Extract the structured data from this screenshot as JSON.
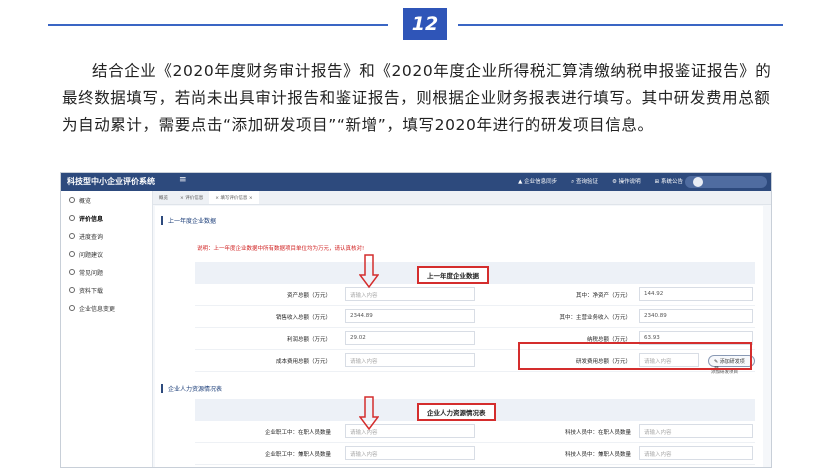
{
  "header": {
    "step_number": "12"
  },
  "intro_text": "结合企业《2020年度财务审计报告》和《2020年度企业所得税汇算清缴纳税申报鉴证报告》的最终数据填写，若尚未出具审计报告和鉴证报告，则根据企业财务报表进行填写。其中研发费用总额为自动累计，需要点击“添加研发项目”“新增”，填写2020年进行的研发项目信息。",
  "app": {
    "title": "科技型中小企业评价系统",
    "menu_icon": "≡",
    "topnav": [
      "▲ 企业信息同步",
      "⌕ 查询验证",
      "⚙ 操作说明",
      "⊞ 系统公告"
    ],
    "sidebar": [
      {
        "label": "概览",
        "active": false
      },
      {
        "label": "评价信息",
        "active": true
      },
      {
        "label": "进度查询",
        "active": false
      },
      {
        "label": "问题建议",
        "active": false
      },
      {
        "label": "常见问题",
        "active": false
      },
      {
        "label": "资料下载",
        "active": false
      },
      {
        "label": "企业信息变更",
        "active": false
      }
    ],
    "tabs": [
      "概览",
      "× 评价信息",
      "× 填写评价信息 ×"
    ],
    "section1_title": "上一年度企业数据",
    "notice": "说明：上一年度企业数据中所有数据项目单位均为万元，请认真核对!",
    "table1_header": "上一年度企业数据",
    "rows1": [
      {
        "l1": "资产总额（万元）",
        "v1": "请输入内容",
        "l2": "其中：净资产（万元）",
        "v2": "144.92"
      },
      {
        "l1": "销售收入总额（万元）",
        "v1": "2344.89",
        "l2": "其中：主营业务收入（万元）",
        "v2": "2340.89"
      },
      {
        "l1": "利润总额（万元）",
        "v1": "29.02",
        "l2": "纳税总额（万元）",
        "v2": "63.93"
      },
      {
        "l1": "成本费用总额（万元）",
        "v1": "请输入内容",
        "l2": "研发费用总额（万元）",
        "v2": "请输入内容"
      }
    ],
    "add_rd_button": "✎ 添加研发项目",
    "add_rd_tooltip": "添加研发项目",
    "section2_title": "企业人力资源情况表",
    "table2_header": "企业人力资源情况表",
    "rows2": [
      {
        "l1": "企业职工中：在职人员数量",
        "v1": "请输入内容",
        "l2": "科技人员中：在职人员数量",
        "v2": "请输入内容"
      },
      {
        "l1": "企业职工中：兼职人员数量",
        "v1": "请输入内容",
        "l2": "科技人员中：兼职人员数量",
        "v2": "请输入内容"
      }
    ]
  },
  "colors": {
    "brand": "#2f55b8",
    "topbar": "#2d4a7d",
    "highlight": "#d42d2d"
  }
}
